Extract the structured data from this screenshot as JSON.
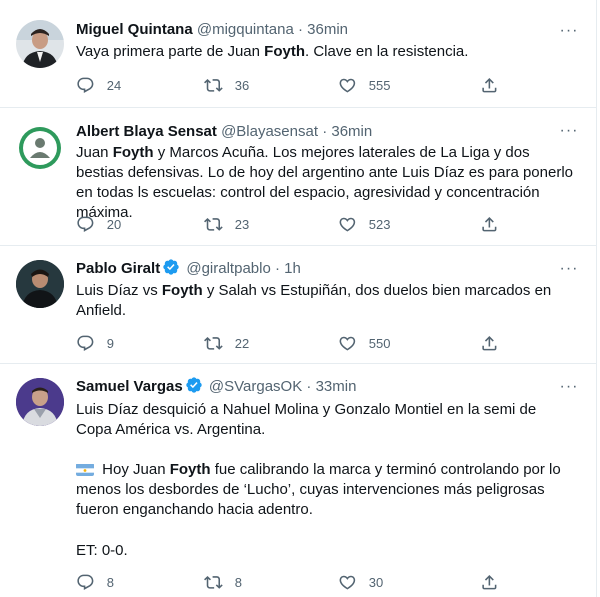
{
  "tweets": [
    {
      "name": "Miguel Quintana",
      "handle": "@migquintana",
      "sep": "·",
      "time": "36min",
      "more": "···",
      "text_parts": [
        "Vaya primera parte de Juan ",
        "Foyth",
        ". Clave en la resistencia."
      ],
      "replies": "24",
      "retweets": "36",
      "likes": "555"
    },
    {
      "name": "Albert Blaya Sensat",
      "handle": "@Blayasensat",
      "sep": "·",
      "time": "36min",
      "more": "···",
      "text_parts": [
        "Juan ",
        "Foyth",
        " y Marcos Acuña. Los mejores laterales de La Liga y dos bestias defensivas. Lo de hoy del argentino ante Luis Díaz es para ponerlo en todas ls escuelas: control del espacio, agresividad y concentración máxima."
      ],
      "replies": "20",
      "retweets": "23",
      "likes": "523"
    },
    {
      "name": "Pablo Giralt",
      "handle": "@giraltpablo",
      "sep": "·",
      "time": "1h",
      "more": "···",
      "verified": true,
      "text_parts": [
        "Luis Díaz vs ",
        "Foyth",
        " y Salah vs Estupiñán, dos duelos bien marcados en Anfield."
      ],
      "replies": "9",
      "retweets": "22",
      "likes": "550"
    },
    {
      "name": "Samuel Vargas",
      "handle": "@SVargasOK",
      "sep": "·",
      "time": "33min",
      "more": "···",
      "verified": true,
      "para1": "Luis Díaz desquició a Nahuel Molina y Gonzalo Montiel en la semi de Copa América vs. Argentina.",
      "text_parts": [
        " Hoy Juan ",
        "Foyth",
        " fue calibrando la marca y terminó controlando por lo menos los desbordes de ‘Lucho’, cuyas intervenciones más peligrosas fueron enganchando hacia adentro."
      ],
      "para3": "ET: 0-0.",
      "flag_emoji": "argentina-flag",
      "replies": "8",
      "retweets": "8",
      "likes": "30"
    }
  ],
  "colors": {
    "text": "#0f1419",
    "muted": "#536471",
    "verified": "#1d9bf0",
    "border": "#e6ecf0"
  }
}
